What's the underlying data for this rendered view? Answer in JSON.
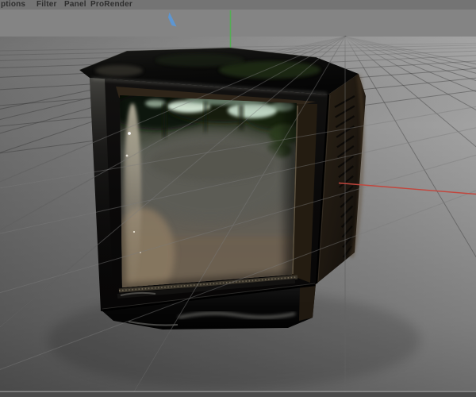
{
  "menubar": {
    "items": [
      {
        "label": "ptions"
      },
      {
        "label": "Filter"
      },
      {
        "label": "Panel"
      },
      {
        "label": "ProRender"
      }
    ]
  },
  "viewport": {
    "scene_object": "vintage CRT television model",
    "screen_reflection": "sunlit park with trees and a wide path",
    "axes": {
      "x": {
        "name": "x-axis",
        "color": "#c2463d"
      },
      "y": {
        "name": "y-axis",
        "color": "#53ad53"
      },
      "z": {
        "name": "z-axis",
        "color": "#5b97d6"
      }
    },
    "colors": {
      "menu_bg": "#747474",
      "menu_text": "#2e2e2e",
      "sky": "#848484",
      "ground_light": "#a0a0a0",
      "ground_dark": "#6f6f6f",
      "grid_line": "#3c3c3c",
      "tv_body": "#0b0a09",
      "tv_side_panel": "#281f13",
      "bottom_strip": "#4b4b4b"
    }
  }
}
